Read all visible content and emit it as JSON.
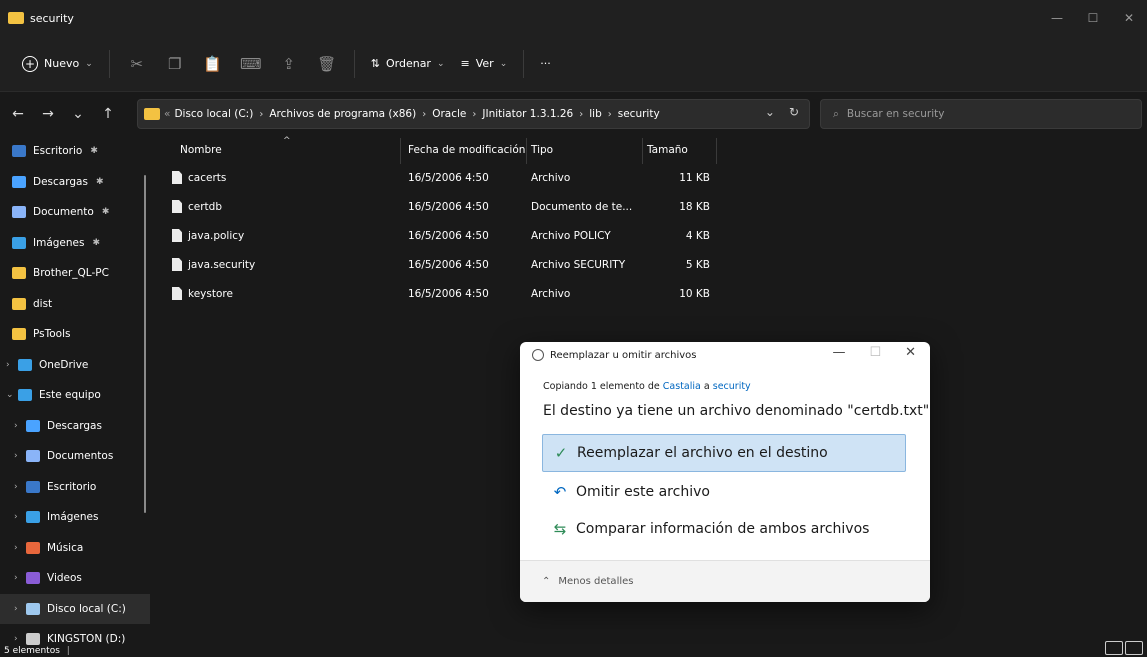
{
  "window": {
    "title": "security"
  },
  "toolbar": {
    "new_label": "Nuevo",
    "sort_label": "Ordenar",
    "view_label": "Ver",
    "more_label": "···"
  },
  "address": {
    "breadcrumb": [
      "Disco local (C:)",
      "Archivos de programa (x86)",
      "Oracle",
      "JInitiator 1.3.1.26",
      "lib",
      "security"
    ],
    "overflow": "«"
  },
  "search": {
    "placeholder": "Buscar en security"
  },
  "sidebar": {
    "items": [
      {
        "label": "Escritorio",
        "icon": "desktop-icon",
        "color": "#3a78c9",
        "pinned": true
      },
      {
        "label": "Descargas",
        "icon": "download-icon",
        "color": "#4aa3ff",
        "pinned": true
      },
      {
        "label": "Documento",
        "icon": "documents-icon",
        "color": "#8ab4f8",
        "pinned": true
      },
      {
        "label": "Imágenes",
        "icon": "pictures-icon",
        "color": "#3aa0e6",
        "pinned": true
      },
      {
        "label": "Brother_QL-PC",
        "icon": "folder-icon",
        "color": "#f3c242"
      },
      {
        "label": "dist",
        "icon": "folder-icon",
        "color": "#f3c242"
      },
      {
        "label": "PsTools",
        "icon": "folder-icon",
        "color": "#f3c242"
      },
      {
        "label": "OneDrive",
        "icon": "cloud-icon",
        "color": "#3aa0e6",
        "chevron": ">"
      },
      {
        "label": "Este equipo",
        "icon": "pc-icon",
        "color": "#3aa0e6",
        "chevron": "v"
      },
      {
        "label": "Descargas",
        "icon": "download-icon",
        "color": "#4aa3ff",
        "chevron": ">"
      },
      {
        "label": "Documentos",
        "icon": "documents-icon",
        "color": "#8ab4f8",
        "chevron": ">"
      },
      {
        "label": "Escritorio",
        "icon": "desktop-icon",
        "color": "#3a78c9",
        "chevron": ">"
      },
      {
        "label": "Imágenes",
        "icon": "pictures-icon",
        "color": "#3aa0e6",
        "chevron": ">"
      },
      {
        "label": "Música",
        "icon": "music-icon",
        "color": "#e8673c",
        "chevron": ">"
      },
      {
        "label": "Videos",
        "icon": "videos-icon",
        "color": "#8a5cd6",
        "chevron": ">"
      },
      {
        "label": "Disco local (C:)",
        "icon": "drive-icon",
        "color": "#9ec8ee",
        "chevron": ">",
        "selected": true
      },
      {
        "label": "KINGSTON (D:)",
        "icon": "usb-drive-icon",
        "color": "#cccccc",
        "chevron": ">"
      }
    ]
  },
  "columns": {
    "name": "Nombre",
    "modified": "Fecha de modificación",
    "type": "Tipo",
    "size": "Tamaño"
  },
  "files": [
    {
      "name": "cacerts",
      "modified": "16/5/2006 4:50",
      "type": "Archivo",
      "size": "11 KB"
    },
    {
      "name": "certdb",
      "modified": "16/5/2006 4:50",
      "type": "Documento de te...",
      "size": "18 KB"
    },
    {
      "name": "java.policy",
      "modified": "16/5/2006 4:50",
      "type": "Archivo POLICY",
      "size": "4 KB"
    },
    {
      "name": "java.security",
      "modified": "16/5/2006 4:50",
      "type": "Archivo SECURITY",
      "size": "5 KB"
    },
    {
      "name": "keystore",
      "modified": "16/5/2006 4:50",
      "type": "Archivo",
      "size": "10 KB"
    }
  ],
  "status": {
    "count": "5 elementos"
  },
  "dialog": {
    "title": "Reemplazar u omitir archivos",
    "copy_prefix": "Copiando 1 elemento de",
    "copy_source": "Castalia",
    "copy_mid": "a",
    "copy_dest": "security",
    "heading": "El destino ya tiene un archivo denominado \"certdb.txt\"",
    "option_replace": "Reemplazar el archivo en el destino",
    "option_skip": "Omitir este archivo",
    "option_compare": "Comparar información de ambos archivos",
    "footer": "Menos detalles"
  },
  "colors": {
    "accent": "#0067c0",
    "folder": "#f3c242",
    "selection": "#cfe3f5",
    "check": "#2e8b57"
  }
}
